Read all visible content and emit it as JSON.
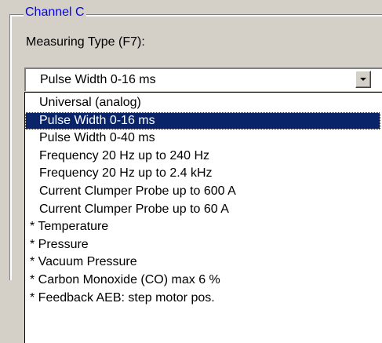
{
  "group": {
    "title": "Channel C",
    "measuring_type_label": "Measuring Type (F7):"
  },
  "combo": {
    "selected_value": "Pulse Width 0-16 ms",
    "button_icon": "chevron-down-icon"
  },
  "dropdown": {
    "items": [
      {
        "label": "Universal (analog)",
        "starred": false,
        "selected": false
      },
      {
        "label": "Pulse Width 0-16 ms",
        "starred": false,
        "selected": true
      },
      {
        "label": "Pulse Width 0-40 ms",
        "starred": false,
        "selected": false
      },
      {
        "label": "Frequency 20 Hz up to 240 Hz",
        "starred": false,
        "selected": false
      },
      {
        "label": "Frequency 20 Hz up to 2.4 kHz",
        "starred": false,
        "selected": false
      },
      {
        "label": "Current Clumper Probe up to 600 A",
        "starred": false,
        "selected": false
      },
      {
        "label": "Current Clumper Probe up to 60 A",
        "starred": false,
        "selected": false
      },
      {
        "label": "* Temperature",
        "starred": true,
        "selected": false
      },
      {
        "label": "* Pressure",
        "starred": true,
        "selected": false
      },
      {
        "label": "* Vacuum Pressure",
        "starred": true,
        "selected": false
      },
      {
        "label": "* Carbon Monoxide (CO) max 6 %",
        "starred": true,
        "selected": false
      },
      {
        "label": "* Feedback AEB: step motor pos.",
        "starred": true,
        "selected": false
      }
    ]
  },
  "colors": {
    "background": "#d4d0c8",
    "title": "#0000ff",
    "selection": "#0a246a",
    "selection_text": "#ffffff"
  }
}
